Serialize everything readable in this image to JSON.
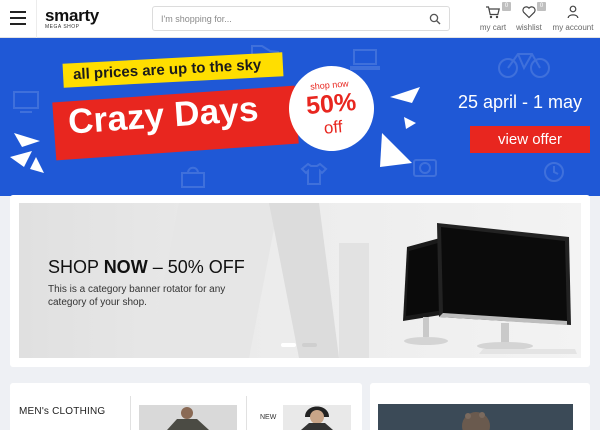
{
  "header": {
    "logo_main": "smarty",
    "logo_sub": "MEGA SHOP",
    "search_placeholder": "I'm shopping for...",
    "cart_label": "my cart",
    "cart_count": "0",
    "wishlist_label": "wishlist",
    "wishlist_count": "0",
    "account_label": "my account"
  },
  "hero": {
    "tagline": "all prices are up to the sky",
    "title": "Crazy Days",
    "shop_now": "shop now",
    "discount": "50%",
    "off": "off",
    "date": "25 april - 1 may",
    "cta": "view offer"
  },
  "rotator": {
    "title_prefix": "SHOP ",
    "title_bold": "NOW",
    "title_suffix": " – 50% OFF",
    "description": "This is a category banner rotator for any category of your shop.",
    "active_slide": 1,
    "slide_count": 2
  },
  "category": {
    "title": "MEN's CLOTHING",
    "new_label": "NEW"
  },
  "colors": {
    "hero_blue": "#1f58d6",
    "accent_red": "#e8261f",
    "accent_yellow": "#ffde00"
  }
}
